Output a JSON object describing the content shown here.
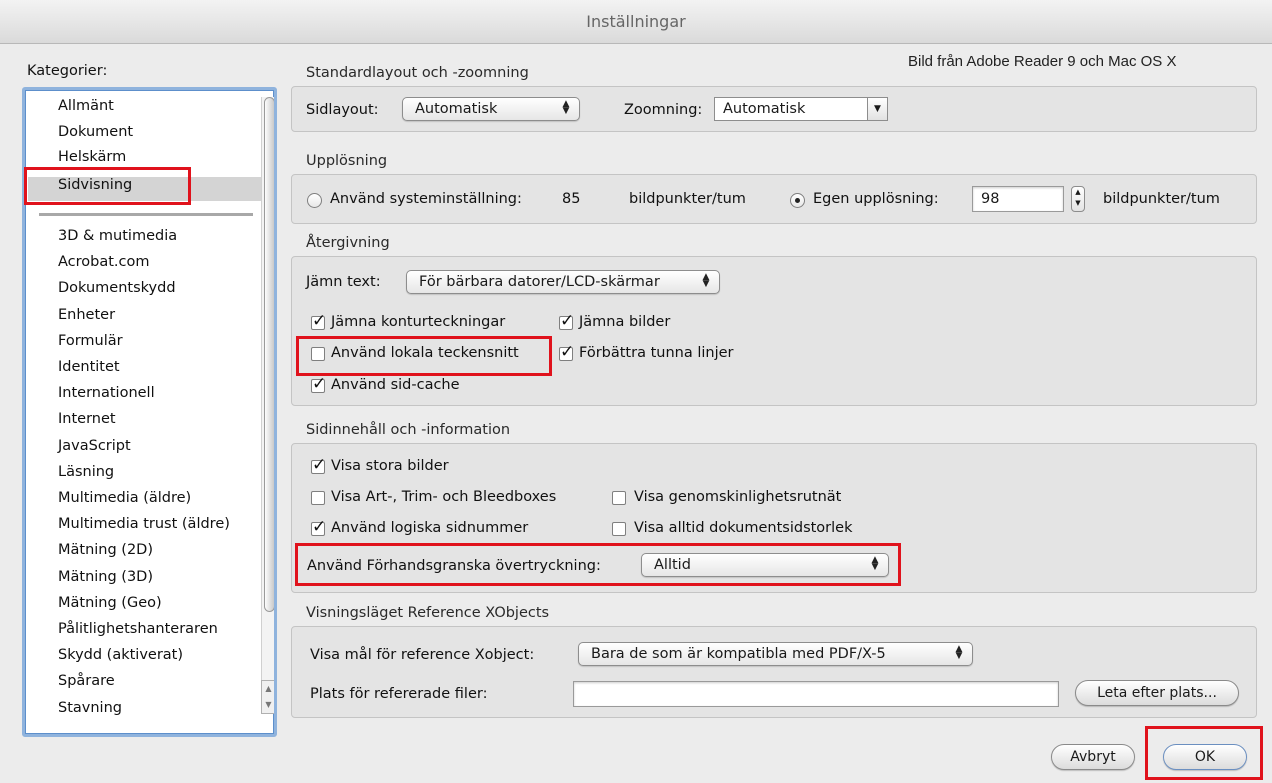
{
  "window": {
    "title": "Inställningar"
  },
  "caption": "Bild från Adobe Reader 9 och Mac OS X",
  "sidebar": {
    "label": "Kategorier:",
    "selected": "Sidvisning",
    "top_items": [
      "Allmänt",
      "Dokument",
      "Helskärm",
      "Sidvisning"
    ],
    "items": [
      "3D & mutimedia",
      "Acrobat.com",
      "Dokumentskydd",
      "Enheter",
      "Formulär",
      "Identitet",
      "Internationell",
      "Internet",
      "JavaScript",
      "Läsning",
      "Multimedia (äldre)",
      "Multimedia trust (äldre)",
      "Mätning (2D)",
      "Mätning (3D)",
      "Mätning (Geo)",
      "Pålitlighetshanteraren",
      "Skydd (aktiverat)",
      "Spårare",
      "Stavning"
    ]
  },
  "layout_zoom": {
    "title": "Standardlayout och -zoomning",
    "page_layout_label": "Sidlayout:",
    "page_layout_value": "Automatisk",
    "zoom_label": "Zoomning:",
    "zoom_value": "Automatisk"
  },
  "resolution": {
    "title": "Upplösning",
    "system_label": "Använd systeminställning:",
    "system_value": "85",
    "system_unit": "bildpunkter/tum",
    "custom_label": "Egen upplösning:",
    "custom_value": "98",
    "custom_unit": "bildpunkter/tum",
    "selected": "custom"
  },
  "rendering": {
    "title": "Återgivning",
    "smooth_text_label": "Jämn text:",
    "smooth_text_value": "För bärbara datorer/LCD-skärmar",
    "checks": [
      {
        "label": "Jämna konturteckningar",
        "checked": true
      },
      {
        "label": "Jämna bilder",
        "checked": true
      },
      {
        "label": "Använd lokala teckensnitt",
        "checked": false
      },
      {
        "label": "Förbättra tunna linjer",
        "checked": true
      },
      {
        "label": "Använd sid-cache",
        "checked": true
      }
    ]
  },
  "page_content": {
    "title": "Sidinnehåll och -information",
    "checks": [
      {
        "label": "Visa stora bilder",
        "checked": true
      },
      {
        "label": "Visa Art-, Trim- och Bleedboxes",
        "checked": false
      },
      {
        "label": "Visa genomskinlighetsrutnät",
        "checked": false
      },
      {
        "label": "Använd logiska sidnummer",
        "checked": true
      },
      {
        "label": "Visa alltid dokumentsidstorlek",
        "checked": false
      }
    ],
    "overprint_label": "Använd Förhandsgranska övertryckning:",
    "overprint_value": "Alltid"
  },
  "xobjects": {
    "title": "Visningsläget Reference XObjects",
    "target_label": "Visa mål för reference Xobject:",
    "target_value": "Bara de som är kompatibla med PDF/X-5",
    "location_label": "Plats för refererade filer:",
    "location_value": "",
    "browse_label": "Leta efter plats..."
  },
  "footer": {
    "cancel_label": "Avbryt",
    "ok_label": "OK"
  },
  "colors": {
    "highlight": "#e0121c",
    "list_focus": "#8fb3dd"
  }
}
